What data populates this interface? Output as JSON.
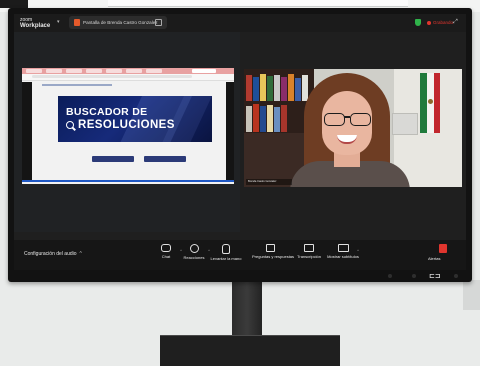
{
  "app": {
    "brand_line1": "zoom",
    "brand_line2": "Workplace",
    "tab_title": "Pantalla de Brenda Castro Gonzalez",
    "recording": "Grabando"
  },
  "shared_screen": {
    "banner_line1": "BUSCADOR DE",
    "banner_line2": "RESOLUCIONES"
  },
  "video": {
    "participant_name": "Brenda Castro Gonzalez"
  },
  "toolbar": {
    "audio_label": "Configuración del audio",
    "buttons": [
      {
        "label": "Chat",
        "icon": "chat-icon"
      },
      {
        "label": "Reacciones",
        "icon": "reactions-icon"
      },
      {
        "label": "Levantar la mano",
        "icon": "raise-hand-icon"
      },
      {
        "label": "Preguntas y respuestas",
        "icon": "qa-icon"
      },
      {
        "label": "Transcripción",
        "icon": "transcript-icon"
      },
      {
        "label": "Mostrar subtítulos",
        "icon": "captions-icon"
      }
    ],
    "alerts_label": "Alertas"
  },
  "colors": {
    "recording": "#e0352e",
    "banner": "#0b1d5a",
    "shield": "#2fb34a"
  }
}
